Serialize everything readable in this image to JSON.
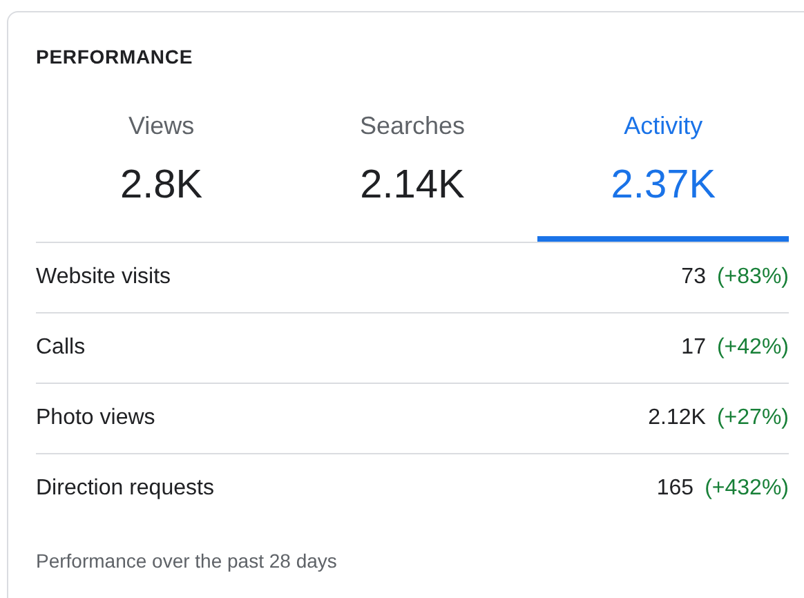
{
  "title": "PERFORMANCE",
  "tabs": [
    {
      "label": "Views",
      "value": "2.8K",
      "selected": false
    },
    {
      "label": "Searches",
      "value": "2.14K",
      "selected": false
    },
    {
      "label": "Activity",
      "value": "2.37K",
      "selected": true
    }
  ],
  "metrics": [
    {
      "label": "Website visits",
      "value": "73",
      "change": "(+83%)"
    },
    {
      "label": "Calls",
      "value": "17",
      "change": "(+42%)"
    },
    {
      "label": "Photo views",
      "value": "2.12K",
      "change": "(+27%)"
    },
    {
      "label": "Direction requests",
      "value": "165",
      "change": "(+432%)"
    }
  ],
  "footer": "Performance over the past 28 days"
}
